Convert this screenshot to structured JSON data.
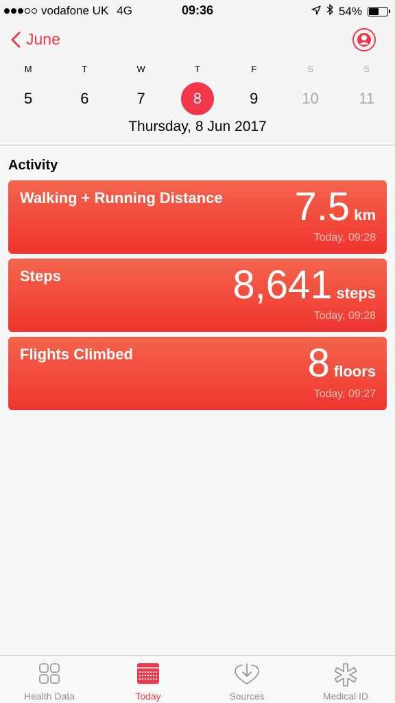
{
  "status_bar": {
    "carrier": "vodafone UK",
    "network": "4G",
    "time": "09:36",
    "battery_percent": "54%",
    "battery_level": 0.54,
    "signal_bars": 3
  },
  "header": {
    "back_label": "June",
    "week": [
      {
        "letter": "M",
        "num": "5"
      },
      {
        "letter": "T",
        "num": "6"
      },
      {
        "letter": "W",
        "num": "7"
      },
      {
        "letter": "T",
        "num": "8"
      },
      {
        "letter": "F",
        "num": "9"
      },
      {
        "letter": "S",
        "num": "10"
      },
      {
        "letter": "S",
        "num": "11"
      }
    ],
    "selected_index": 3,
    "date_label": "Thursday, 8 Jun 2017"
  },
  "activity": {
    "title": "Activity",
    "cards": [
      {
        "title": "Walking + Running Distance",
        "value": "7.5",
        "unit": "km",
        "time": "Today, 09:28"
      },
      {
        "title": "Steps",
        "value": "8,641",
        "unit": "steps",
        "time": "Today, 09:28"
      },
      {
        "title": "Flights Climbed",
        "value": "8",
        "unit": "floors",
        "time": "Today, 09:27"
      }
    ]
  },
  "tab_bar": {
    "tabs": [
      {
        "label": "Health Data",
        "icon": "grid-icon"
      },
      {
        "label": "Today",
        "icon": "calendar-icon"
      },
      {
        "label": "Sources",
        "icon": "heart-download-icon"
      },
      {
        "label": "Medical ID",
        "icon": "asterisk-icon"
      }
    ],
    "active_index": 1
  },
  "colors": {
    "accent": "#f2364b",
    "card_top": "#f3654d",
    "card_bottom": "#ee3430"
  }
}
